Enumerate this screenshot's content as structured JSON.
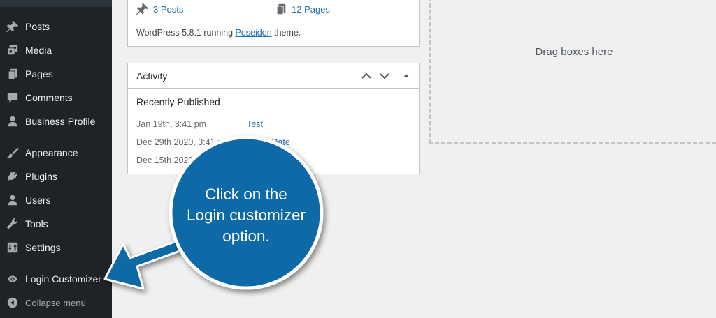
{
  "sidebar": {
    "items": [
      {
        "label": "Posts",
        "icon": "pushpin-icon"
      },
      {
        "label": "Media",
        "icon": "media-icon"
      },
      {
        "label": "Pages",
        "icon": "pages-icon"
      },
      {
        "label": "Comments",
        "icon": "comment-icon"
      },
      {
        "label": "Business Profile",
        "icon": "user-icon"
      },
      {
        "label": "Appearance",
        "icon": "paintbrush-icon"
      },
      {
        "label": "Plugins",
        "icon": "plugin-icon"
      },
      {
        "label": "Users",
        "icon": "users-icon"
      },
      {
        "label": "Tools",
        "icon": "wrench-icon"
      },
      {
        "label": "Settings",
        "icon": "settings-icon"
      },
      {
        "label": "Login Customizer",
        "icon": "eye-icon"
      }
    ],
    "collapse_label": "Collapse menu"
  },
  "glance": {
    "posts": "3 Posts",
    "pages": "12 Pages",
    "wp_prefix": "WordPress 5.8.1 running ",
    "theme": "Poseidon",
    "wp_suffix": " theme."
  },
  "activity": {
    "title": "Activity",
    "recent_heading": "Recently Published",
    "rows": [
      {
        "date": "Jan 19th, 3:41 pm",
        "post": "Test"
      },
      {
        "date": "Dec 29th 2020, 3:41 pm",
        "post": "Event Date"
      },
      {
        "date": "Dec 15th 2020",
        "post": ""
      }
    ]
  },
  "dropzone": {
    "text": "Drag boxes here"
  },
  "callout": {
    "line1": "Click on the",
    "line2": "Login customizer",
    "line3": "option.",
    "color": "#0b6aa6"
  },
  "colors": {
    "sidebar_bg": "#1d2327",
    "link": "#2271b1",
    "page_bg": "#f0f0f1"
  }
}
